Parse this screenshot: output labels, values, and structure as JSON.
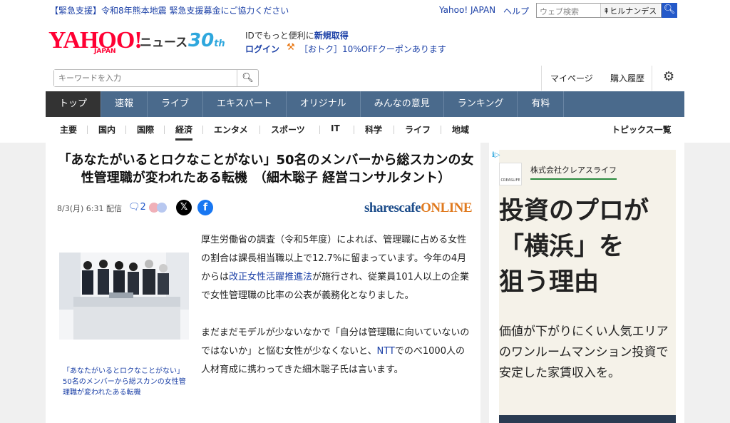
{
  "topbar": {
    "alert": "【緊急支援】令和8年熊本地震 緊急支援募金にご協力ください",
    "yahoo_japan": "Yahoo! JAPAN",
    "help": "ヘルプ",
    "web_search_placeholder": "ウェブ検索",
    "search_hint": "ヒルナンデス"
  },
  "header": {
    "logo": "YAHOO!",
    "logo_sub": "JAPAN",
    "news": "ニュース",
    "anniversary": "30",
    "anniversary_suffix": "th",
    "id_text": "IDでもっと便利に",
    "id_link": "新規取得",
    "login": "ログイン",
    "coupon": "［おトク］10%OFFクーポンあります",
    "keyword_placeholder": "キーワードを入力",
    "mypage": "マイページ",
    "purchase_history": "購入履歴"
  },
  "nav": {
    "items": [
      {
        "label": "トップ"
      },
      {
        "label": "速報"
      },
      {
        "label": "ライブ"
      },
      {
        "label": "エキスパート"
      },
      {
        "label": "オリジナル"
      },
      {
        "label": "みんなの意見"
      },
      {
        "label": "ランキング"
      },
      {
        "label": "有料"
      }
    ]
  },
  "subnav": {
    "items": [
      "主要",
      "国内",
      "国際",
      "経済",
      "エンタメ",
      "スポーツ",
      "IT",
      "科学",
      "ライフ",
      "地域"
    ],
    "topics_list": "トピックス一覧"
  },
  "article": {
    "title": "「あなたがいるとロクなことがない」50名のメンバーから総スカンの女性管理職が変われたある転機　（細木聡子 経営コンサルタント）",
    "date": "8/3(月) 6:31 配信",
    "comment_count": "2",
    "publisher": "sharescafe",
    "publisher_suffix": "ONLINE",
    "caption": "「あなたがいるとロクなことがない」50名のメンバーから総スカンの女性管理職が変われたある転機",
    "p1_a": "厚生労働省の調査（令和5年度）によれば、管理職に占める女性の割合は課長相当職以上で12.7%に留まっています。今年の4月からは",
    "p1_link": "改正女性活躍推進法",
    "p1_b": "が施行され、従業員101人以上の企業で女性管理職の比率の公表が義務化となりました。",
    "p2_a": "まだまだモデルが少ないなかで「自分は管理職に向いていないのではないか」と悩む女性が少なくないと、",
    "p2_link": "NTT",
    "p2_b": "でのべ1000人の人材育成に携わってきた細木聡子氏は言います。"
  },
  "ad": {
    "company": "株式会社クレアスライフ",
    "logo_text": "CREASLIFE",
    "headline_1": "投資のプロが",
    "headline_2": "「横浜」を",
    "headline_3": "狙う理由",
    "body": "価値が下がりにくい人気エリアのワンルームマンション投資で安定した家賃収入を。"
  },
  "colors": {
    "nav_bg": "#4a6a8c",
    "link": "#1a3fa6",
    "brand_red": "#ff0033",
    "search_btn": "#2459c9"
  }
}
